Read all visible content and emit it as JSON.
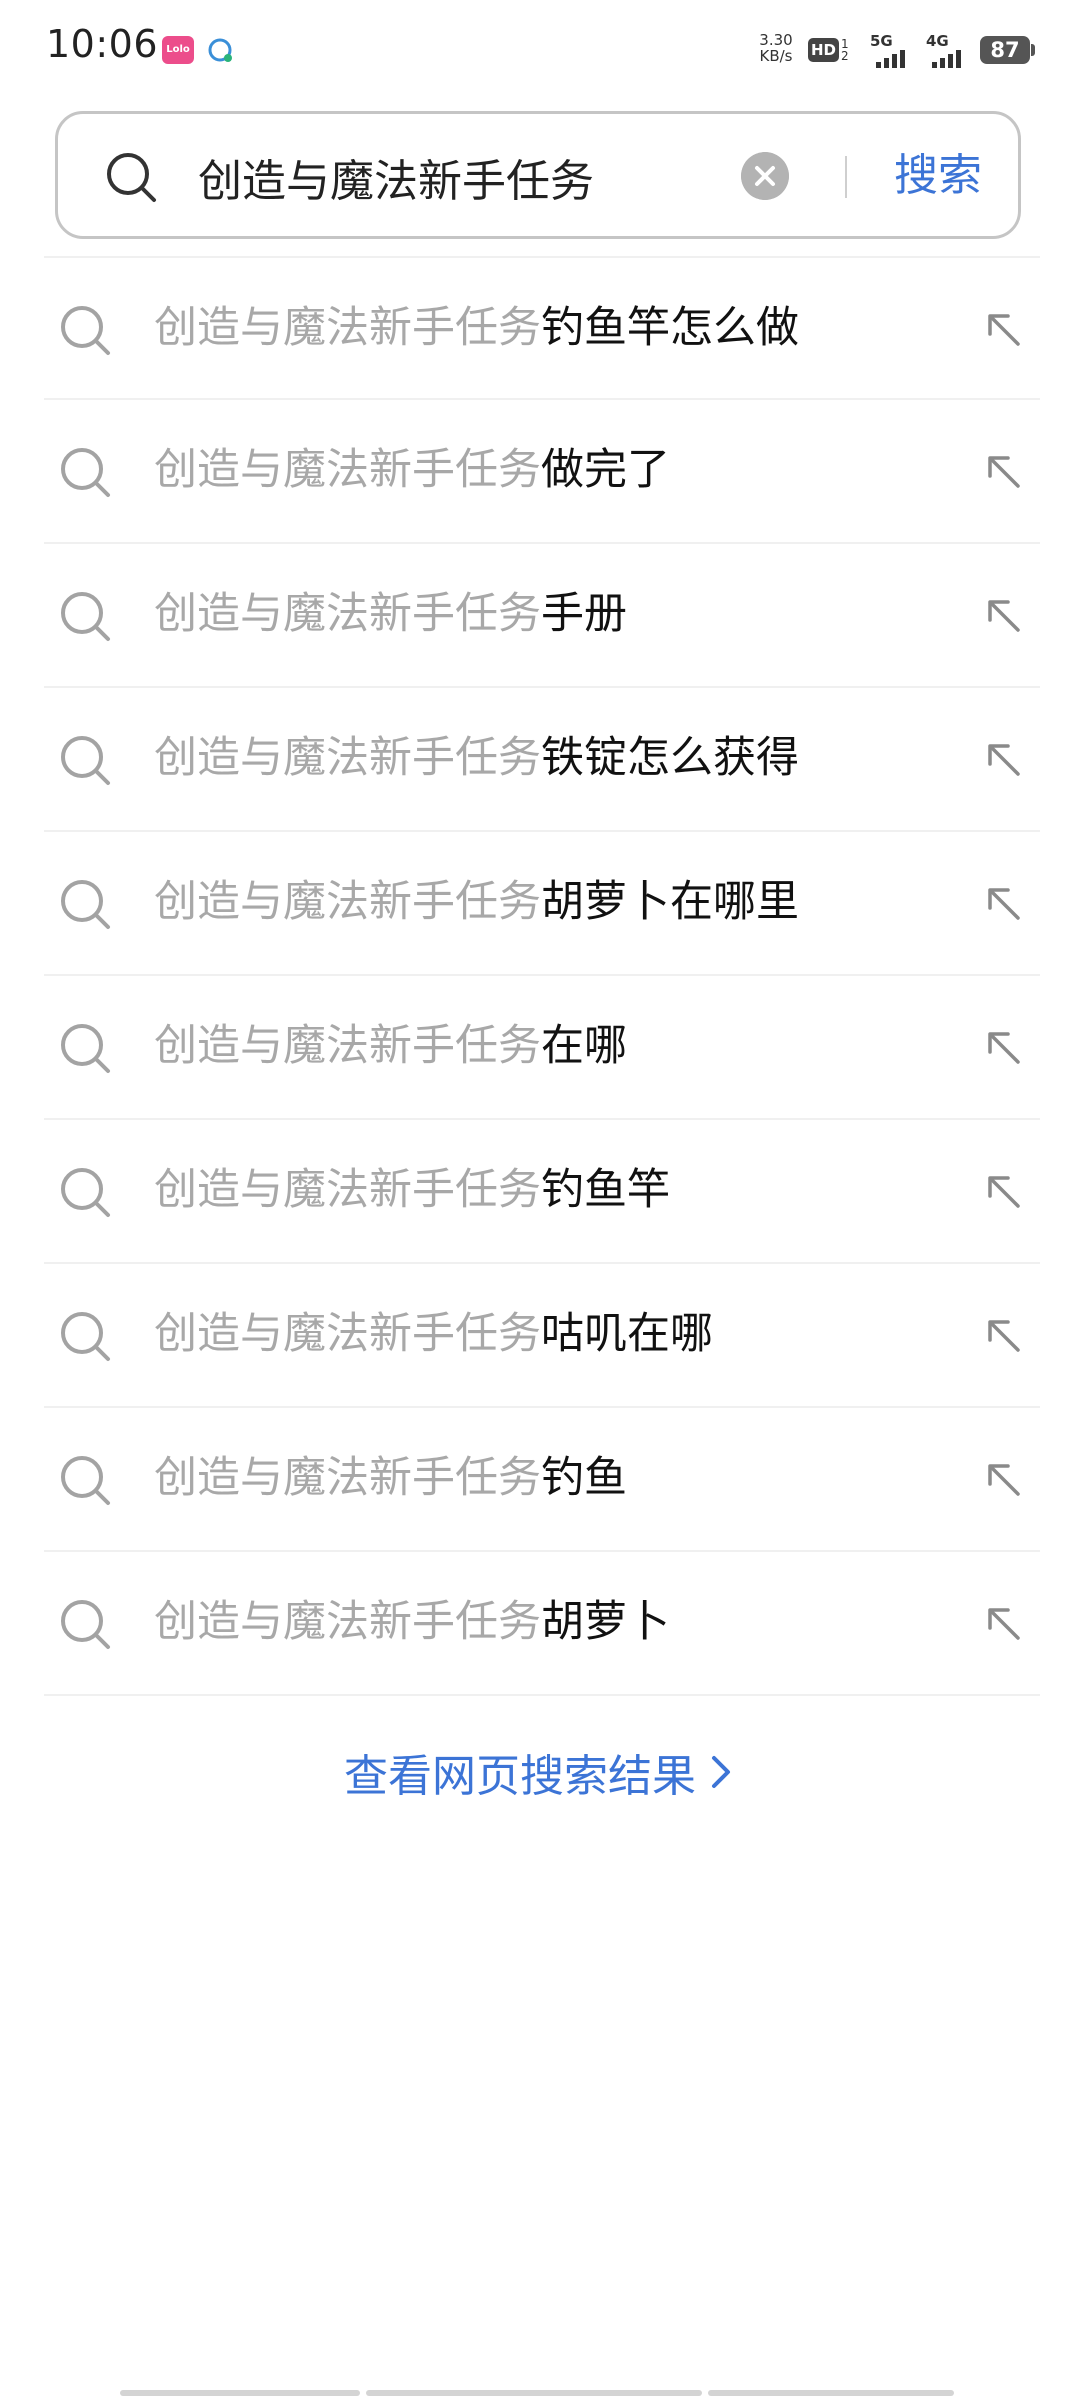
{
  "status_bar": {
    "time": "10:06",
    "app_badge_text": "Lolo",
    "net_speed_value": "3.30",
    "net_speed_unit": "KB/s",
    "hd_label": "HD",
    "hd_sup": "1",
    "hd_sub": "2",
    "signal_1_label": "5G",
    "signal_2_label": "4G",
    "battery_level": "87",
    "icons": [
      "app-notification-icon",
      "chat-bubble-icon",
      "hd-volte-icon",
      "signal-5g-icon",
      "signal-4g-icon",
      "battery-icon"
    ]
  },
  "search": {
    "query": "创造与魔法新手任务",
    "button_label": "搜索",
    "colors": {
      "accent": "#3c74d6",
      "border": "#c5c5c5",
      "clear_button": "#b3b3b3"
    }
  },
  "suggestions": [
    {
      "prefix": "创造与魔法新手任务",
      "suffix": "钓鱼竿怎么做"
    },
    {
      "prefix": "创造与魔法新手任务",
      "suffix": "做完了"
    },
    {
      "prefix": "创造与魔法新手任务",
      "suffix": "手册"
    },
    {
      "prefix": "创造与魔法新手任务",
      "suffix": "铁锭怎么获得"
    },
    {
      "prefix": "创造与魔法新手任务",
      "suffix": "胡萝卜在哪里"
    },
    {
      "prefix": "创造与魔法新手任务",
      "suffix": "在哪"
    },
    {
      "prefix": "创造与魔法新手任务",
      "suffix": "钓鱼竿"
    },
    {
      "prefix": "创造与魔法新手任务",
      "suffix": "咕叽在哪"
    },
    {
      "prefix": "创造与魔法新手任务",
      "suffix": "钓鱼"
    },
    {
      "prefix": "创造与魔法新手任务",
      "suffix": "胡萝卜"
    }
  ],
  "view_web_results": {
    "label": "查看网页搜索结果"
  }
}
